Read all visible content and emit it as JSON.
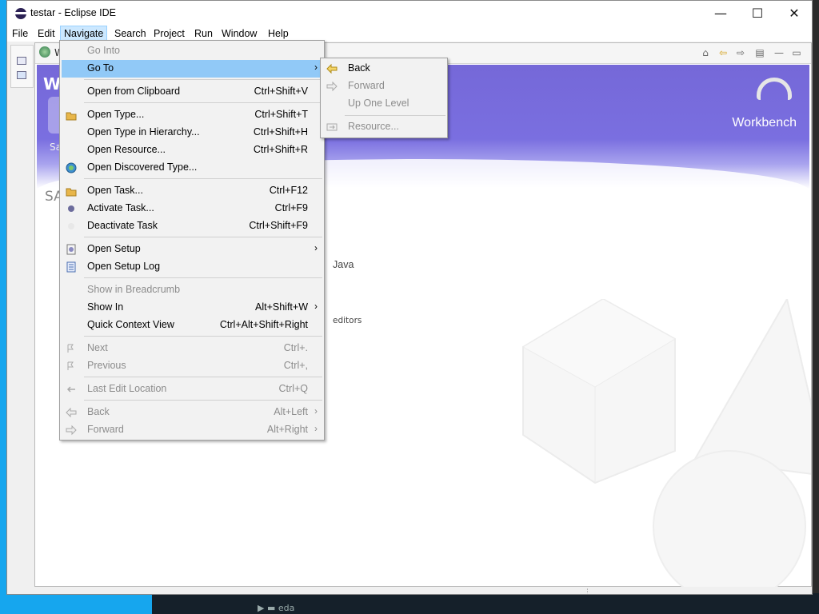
{
  "window": {
    "title": "testar - Eclipse IDE"
  },
  "menubar": [
    "File",
    "Edit",
    "Navigate",
    "Search",
    "Project",
    "Run",
    "Window",
    "Help"
  ],
  "editor": {
    "tab_label": "W",
    "banner_letter": "W",
    "workbench_label": "Workbench",
    "samples_label": "Sa",
    "section_letters": "SA",
    "java_text": "Java",
    "editors_text": "editors"
  },
  "navigate_menu": {
    "items": [
      {
        "label": "Go Into",
        "shortcut": "",
        "disabled": true,
        "icon": "none"
      },
      {
        "label": "Go To",
        "shortcut": "",
        "arrow": "›",
        "highlighted": true,
        "icon": "none"
      },
      {
        "label": "Open from Clipboard",
        "shortcut": "Ctrl+Shift+V",
        "icon": "none"
      },
      {
        "label": "Open Type...",
        "shortcut": "Ctrl+Shift+T",
        "icon": "open-type-icon"
      },
      {
        "label": "Open Type in Hierarchy...",
        "shortcut": "Ctrl+Shift+H",
        "icon": "none"
      },
      {
        "label": "Open Resource...",
        "shortcut": "Ctrl+Shift+R",
        "icon": "none"
      },
      {
        "label": "Open Discovered Type...",
        "shortcut": "",
        "icon": "discovered-type-icon"
      },
      {
        "label": "Open Task...",
        "shortcut": "Ctrl+F12",
        "icon": "open-task-icon"
      },
      {
        "label": "Activate Task...",
        "shortcut": "Ctrl+F9",
        "icon": "activate-task-icon"
      },
      {
        "label": "Deactivate Task",
        "shortcut": "Ctrl+Shift+F9",
        "icon": "deactivate-task-icon"
      },
      {
        "label": "Open Setup",
        "shortcut": "",
        "arrow": "›",
        "icon": "setup-icon"
      },
      {
        "label": "Open Setup Log",
        "shortcut": "",
        "icon": "setup-log-icon"
      },
      {
        "label": "Show in Breadcrumb",
        "shortcut": "",
        "disabled": true,
        "icon": "none"
      },
      {
        "label": "Show In",
        "shortcut": "Alt+Shift+W",
        "arrow": "›",
        "icon": "none"
      },
      {
        "label": "Quick Context View",
        "shortcut": "Ctrl+Alt+Shift+Right",
        "icon": "none"
      },
      {
        "label": "Next",
        "shortcut": "Ctrl+.",
        "disabled": true,
        "icon": "next-icon"
      },
      {
        "label": "Previous",
        "shortcut": "Ctrl+,",
        "disabled": true,
        "icon": "previous-icon"
      },
      {
        "label": "Last Edit Location",
        "shortcut": "Ctrl+Q",
        "disabled": true,
        "icon": "last-edit-icon"
      },
      {
        "label": "Back",
        "shortcut": "Alt+Left",
        "arrow": "›",
        "disabled": true,
        "icon": "back-arrow-icon"
      },
      {
        "label": "Forward",
        "shortcut": "Alt+Right",
        "arrow": "›",
        "disabled": true,
        "icon": "forward-arrow-icon"
      }
    ]
  },
  "goto_submenu": {
    "items": [
      {
        "label": "Back",
        "disabled": false,
        "icon": "back-arrow-icon"
      },
      {
        "label": "Forward",
        "disabled": true,
        "icon": "forward-arrow-icon"
      },
      {
        "label": "Up One Level",
        "disabled": true,
        "icon": "none"
      },
      {
        "label": "Resource...",
        "disabled": true,
        "icon": "resource-icon"
      }
    ]
  },
  "colors": {
    "menu_highlight": "#91c9f7",
    "banner": "#7568d8",
    "desktop": "#16a6ee"
  }
}
